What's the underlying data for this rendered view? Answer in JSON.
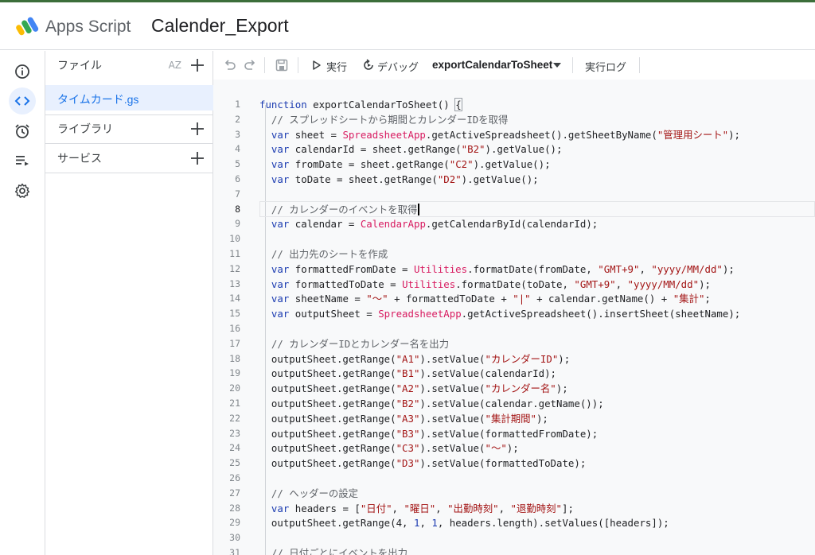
{
  "header": {
    "app_name": "Apps Script",
    "project_title": "Calender_Export"
  },
  "rail": {
    "items": [
      {
        "icon": "info-icon",
        "active": false
      },
      {
        "icon": "code-icon",
        "active": true
      },
      {
        "icon": "alarm-clock-icon",
        "active": false
      },
      {
        "icon": "run-list-icon",
        "active": false
      },
      {
        "icon": "gear-icon",
        "active": false
      }
    ]
  },
  "sidebar": {
    "files_label": "ファイル",
    "sort_label": "AZ",
    "active_file": "タイムカード.gs",
    "libraries_label": "ライブラリ",
    "services_label": "サービス"
  },
  "toolbar": {
    "run_label": "実行",
    "debug_label": "デバッグ",
    "function_name": "exportCalendarToSheet",
    "log_label": "実行ログ"
  },
  "editor": {
    "current_line": 8,
    "lines": [
      {
        "n": "1",
        "code": "<span class=\"kw\">function</span> exportCalendarToSheet() <span class=\"bracket\">{</span>"
      },
      {
        "n": "2",
        "code": "  <span class=\"cm\">// スプレッドシートから期間とカレンダーIDを取得</span>"
      },
      {
        "n": "3",
        "code": "  <span class=\"kw\">var</span> sheet = <span class=\"cls\">SpreadsheetApp</span>.getActiveSpreadsheet().getSheetByName(<span class=\"str\">\"管理用シート\"</span>);"
      },
      {
        "n": "4",
        "code": "  <span class=\"kw\">var</span> calendarId = sheet.getRange(<span class=\"str\">\"B2\"</span>).getValue();"
      },
      {
        "n": "5",
        "code": "  <span class=\"kw\">var</span> fromDate = sheet.getRange(<span class=\"str\">\"C2\"</span>).getValue();"
      },
      {
        "n": "6",
        "code": "  <span class=\"kw\">var</span> toDate = sheet.getRange(<span class=\"str\">\"D2\"</span>).getValue();"
      },
      {
        "n": "7",
        "code": ""
      },
      {
        "n": "8",
        "code": "  <span class=\"cm\">// カレンダーのイベントを取得</span>"
      },
      {
        "n": "9",
        "code": "  <span class=\"kw\">var</span> calendar = <span class=\"cls\">CalendarApp</span>.getCalendarById(calendarId);"
      },
      {
        "n": "10",
        "code": ""
      },
      {
        "n": "11",
        "code": "  <span class=\"cm\">// 出力先のシートを作成</span>"
      },
      {
        "n": "12",
        "code": "  <span class=\"kw\">var</span> formattedFromDate = <span class=\"cls\">Utilities</span>.formatDate(fromDate, <span class=\"str\">\"GMT+9\"</span>, <span class=\"str\">\"yyyy/MM/dd\"</span>);"
      },
      {
        "n": "13",
        "code": "  <span class=\"kw\">var</span> formattedToDate = <span class=\"cls\">Utilities</span>.formatDate(toDate, <span class=\"str\">\"GMT+9\"</span>, <span class=\"str\">\"yyyy/MM/dd\"</span>);"
      },
      {
        "n": "14",
        "code": "  <span class=\"kw\">var</span> sheetName = <span class=\"str\">\"〜\"</span> + formattedToDate + <span class=\"str\">\"|\"</span> + calendar.getName() + <span class=\"str\">\"集計\"</span>;"
      },
      {
        "n": "15",
        "code": "  <span class=\"kw\">var</span> outputSheet = <span class=\"cls\">SpreadsheetApp</span>.getActiveSpreadsheet().insertSheet(sheetName);"
      },
      {
        "n": "16",
        "code": ""
      },
      {
        "n": "17",
        "code": "  <span class=\"cm\">// カレンダーIDとカレンダー名を出力</span>"
      },
      {
        "n": "18",
        "code": "  outputSheet.getRange(<span class=\"str\">\"A1\"</span>).setValue(<span class=\"str\">\"カレンダーID\"</span>);"
      },
      {
        "n": "19",
        "code": "  outputSheet.getRange(<span class=\"str\">\"B1\"</span>).setValue(calendarId);"
      },
      {
        "n": "20",
        "code": "  outputSheet.getRange(<span class=\"str\">\"A2\"</span>).setValue(<span class=\"str\">\"カレンダー名\"</span>);"
      },
      {
        "n": "21",
        "code": "  outputSheet.getRange(<span class=\"str\">\"B2\"</span>).setValue(calendar.getName());"
      },
      {
        "n": "22",
        "code": "  outputSheet.getRange(<span class=\"str\">\"A3\"</span>).setValue(<span class=\"str\">\"集計期間\"</span>);"
      },
      {
        "n": "23",
        "code": "  outputSheet.getRange(<span class=\"str\">\"B3\"</span>).setValue(formattedFromDate);"
      },
      {
        "n": "24",
        "code": "  outputSheet.getRange(<span class=\"str\">\"C3\"</span>).setValue(<span class=\"str\">\"〜\"</span>);"
      },
      {
        "n": "25",
        "code": "  outputSheet.getRange(<span class=\"str\">\"D3\"</span>).setValue(formattedToDate);"
      },
      {
        "n": "26",
        "code": ""
      },
      {
        "n": "27",
        "code": "  <span class=\"cm\">// ヘッダーの設定</span>"
      },
      {
        "n": "28",
        "code": "  <span class=\"kw\">var</span> headers = [<span class=\"str\">\"日付\"</span>, <span class=\"str\">\"曜日\"</span>, <span class=\"str\">\"出勤時刻\"</span>, <span class=\"str\">\"退勤時刻\"</span>];"
      },
      {
        "n": "29",
        "code": "  outputSheet.getRange(4, <span class=\"kw\">1</span>, <span class=\"kw\">1</span>, headers.length).setValues([headers]);"
      },
      {
        "n": "30",
        "code": ""
      },
      {
        "n": "31",
        "code": "  <span class=\"cm\">// 日付ごとにイベントを出力</span>"
      }
    ]
  }
}
